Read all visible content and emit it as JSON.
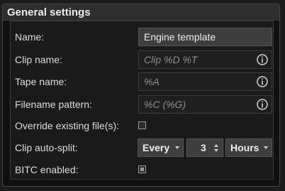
{
  "panel": {
    "title": "General settings"
  },
  "fields": {
    "name": {
      "label": "Name:",
      "value": "Engine template"
    },
    "clip_name": {
      "label": "Clip name:",
      "placeholder": "Clip %D %T"
    },
    "tape_name": {
      "label": "Tape name:",
      "placeholder": "%A"
    },
    "filename_pattern": {
      "label": "Filename pattern:",
      "placeholder": "%C (%G)"
    },
    "override_existing": {
      "label": "Override existing file(s):",
      "checked": false
    },
    "clip_auto_split": {
      "label": "Clip auto-split:",
      "mode": "Every",
      "count": "3",
      "unit": "Hours"
    },
    "bitc_enabled": {
      "label": "BITC enabled:",
      "checked": true
    }
  },
  "icons": {
    "info": "info-circle-icon",
    "dropdown": "chevron-down-icon",
    "spinner": "spinner-arrows-icon"
  }
}
